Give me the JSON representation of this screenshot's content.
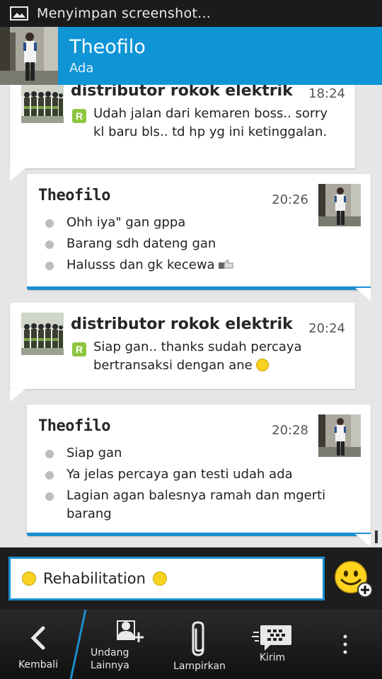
{
  "status_bar": {
    "notification": "Menyimpan screenshot..."
  },
  "header": {
    "name": "Theofilo",
    "status": "Ada"
  },
  "messages": [
    {
      "sender": "distributor rokok elektrik /...",
      "time": "18:24",
      "badge": "R",
      "text": "Udah jalan dari kemaren boss.. sorry kl baru bls.. td hp yg ini ketinggalan."
    },
    {
      "sender": "Theofilo",
      "time": "20:26",
      "items": [
        "Ohh iya\" gan gppa",
        "Barang sdh dateng gan",
        "Halusss dan gk kecewa"
      ]
    },
    {
      "sender": "distributor rokok elektrik /...",
      "time": "20:24",
      "badge": "R",
      "text": "Siap gan.. thanks sudah percaya bertransaksi dengan ane"
    },
    {
      "sender": "Theofilo",
      "time": "20:28",
      "items": [
        "Siap gan",
        "Ya jelas percaya gan testi udah ada",
        "Lagian agan balesnya ramah dan mgerti barang"
      ]
    }
  ],
  "composer": {
    "value": "Rehabilitation"
  },
  "bottom_bar": {
    "back": "Kembali",
    "invite": "Undang\nLainnya",
    "attach": "Lampirkan",
    "send": "Kirim"
  },
  "colors": {
    "header": "#0f94d6",
    "accent": "#1a8fcf",
    "badge": "#8dc63f"
  },
  "icons": [
    "image-icon",
    "smiley-icon",
    "add-icon",
    "back-icon",
    "invite-icon",
    "paperclip-icon",
    "bbm-send-icon",
    "overflow-menu-icon"
  ]
}
